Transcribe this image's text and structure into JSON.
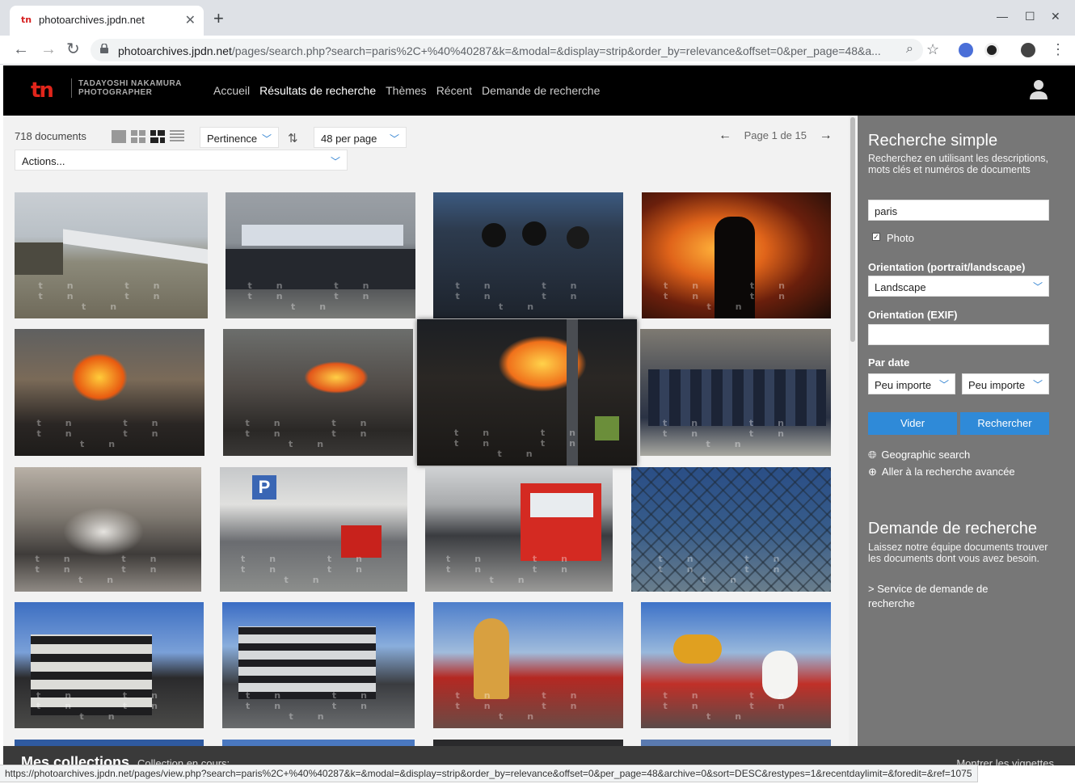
{
  "browser": {
    "tab_title": "photoarchives.jpdn.net",
    "tab_favicon": "tn",
    "url_host": "photoarchives.jpdn.net",
    "url_path": "/pages/search.php?search=paris%2C+%40%40287&k=&modal=&display=strip&order_by=relevance&offset=0&per_page=48&a...",
    "status_url": "https://photoarchives.jpdn.net/pages/view.php?search=paris%2C+%40%40287&k=&modal=&display=strip&order_by=relevance&offset=0&per_page=48&archive=0&sort=DESC&restypes=1&recentdaylimit=&foredit=&ref=1075"
  },
  "header": {
    "logo_mark": "tn",
    "logo_line1": "TADAYOSHI NAKAMURA",
    "logo_line2": "PHOTOGRAPHER",
    "menu": [
      {
        "label": "Accueil"
      },
      {
        "label": "Résultats de recherche"
      },
      {
        "label": "Thèmes"
      },
      {
        "label": "Récent"
      },
      {
        "label": "Demande de recherche"
      }
    ]
  },
  "results": {
    "count": "718 documents",
    "sort_label": "Pertinence",
    "per_page_label": "48 per page",
    "actions_label": "Actions...",
    "page_label": "Page 1 de 15",
    "watermark": "tn tn tn tn tn"
  },
  "sidebar": {
    "search_title": "Recherche simple",
    "search_desc": "Recherchez en utilisant les descriptions, mots clés et numéros de documents",
    "search_value": "paris",
    "photo_label": "Photo",
    "orientation_label": "Orientation (portrait/landscape)",
    "orientation_value": "Landscape",
    "exif_label": "Orientation (EXIF)",
    "date_label": "Par date",
    "date_from": "Peu importe",
    "date_to": "Peu importe",
    "clear_button": "Vider",
    "search_button": "Rechercher",
    "geo_link": "Geographic search",
    "advanced_link": "Aller à la recherche avancée",
    "request_title": "Demande de recherche",
    "request_desc": "Laissez notre équipe documents trouver les documents dont vous avez besoin.",
    "request_link": "> Service de demande de recherche"
  },
  "collections": {
    "title": "Mes collections",
    "current": "Collection en cours:",
    "show_thumbs": "Montrer les vignettes"
  },
  "colors": {
    "accent": "#2f8ad8",
    "brand_red": "#e1251b",
    "sidebar_bg": "#777777"
  }
}
